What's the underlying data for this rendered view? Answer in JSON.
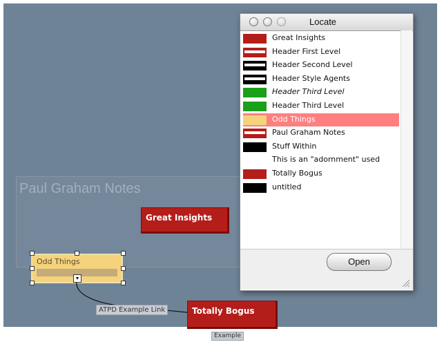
{
  "window": {
    "title": "Locate",
    "open_label": "Open"
  },
  "locate_list": [
    {
      "label": "Great Insights",
      "swatch": "solid-red",
      "italic": false,
      "selected": false
    },
    {
      "label": "Header First Level",
      "swatch": "hdr-red",
      "italic": false,
      "selected": false
    },
    {
      "label": "Header Second Level",
      "swatch": "hdr-black",
      "italic": false,
      "selected": false
    },
    {
      "label": "Header Style Agents",
      "swatch": "hdr-black",
      "italic": false,
      "selected": false
    },
    {
      "label": "Header Third Level",
      "swatch": "solid-green",
      "italic": true,
      "selected": false
    },
    {
      "label": "Header Third Level",
      "swatch": "solid-green",
      "italic": false,
      "selected": false
    },
    {
      "label": "Odd Things",
      "swatch": "solid-yellow",
      "italic": false,
      "selected": true
    },
    {
      "label": "Paul Graham Notes",
      "swatch": "hdr-red",
      "italic": false,
      "selected": false
    },
    {
      "label": "Stuff Within",
      "swatch": "solid-black",
      "italic": false,
      "selected": false
    },
    {
      "label": "This is an \"adornment\" used",
      "swatch": "none",
      "italic": false,
      "selected": false
    },
    {
      "label": "Totally Bogus",
      "swatch": "solid-red",
      "italic": false,
      "selected": false
    },
    {
      "label": "untitled",
      "swatch": "solid-black",
      "italic": false,
      "selected": false
    }
  ],
  "map": {
    "adornment_title": "Paul Graham Notes",
    "note_great_insights": "Great Insights",
    "note_odd_things": "Odd Things",
    "note_totally_bogus": "Totally Bogus",
    "link_label": "ATPD Example Link",
    "example_label": "Example"
  },
  "colors": {
    "canvas": "#6f8397",
    "note_red": "#b41e1a",
    "note_yellow": "#f5d27c",
    "selection": "#ff7f7f"
  }
}
